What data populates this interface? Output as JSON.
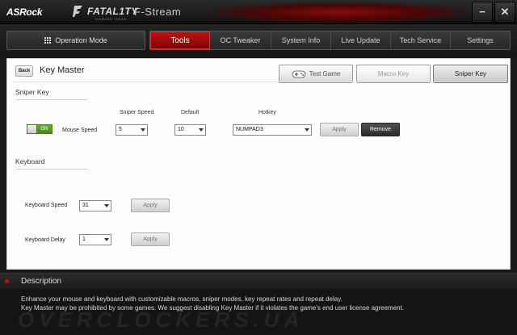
{
  "titlebar": {
    "brand": "ASRock",
    "fatality": "FATAL1TY",
    "fatality_sub": "GAMING GEAR",
    "app_name": "F-Stream",
    "min_label": "−",
    "close_label": "✕"
  },
  "tabs": {
    "operation_mode": "Operation Mode",
    "items": [
      "Tools",
      "OC Tweaker",
      "System Info",
      "Live Update",
      "Tech Service",
      "Settings"
    ],
    "active": "Tools"
  },
  "page": {
    "back_label": "Back",
    "title": "Key Master",
    "test_game_label": "Test Game",
    "macro_key_label": "Macro Key",
    "sniper_key_label": "Sniper Key"
  },
  "sniper": {
    "section_title": "Sniper Key",
    "toggle_label": "ON",
    "row_label": "Mouse Speed",
    "col_sniper_speed": "Sniper Speed",
    "col_default": "Default",
    "col_hotkey": "Hotkey",
    "sniper_speed_value": "5",
    "default_value": "10",
    "hotkey_value": "NUMPAD3",
    "apply_label": "Apply",
    "remove_label": "Remove"
  },
  "keyboard": {
    "section_title": "Keyboard",
    "speed_label": "Keyboard Speed",
    "speed_value": "31",
    "speed_apply": "Apply",
    "delay_label": "Keyboard Delay",
    "delay_value": "1",
    "delay_apply": "Apply"
  },
  "description": {
    "title": "Description",
    "line1": "Enhance your mouse and keyboard with customizable macros, sniper modes, key repeat rates and repeat delay.",
    "line2": "Key Master may be prohibited by some games. We suggest disabling Key Master if it violates the game's end user license agreement.",
    "watermark": "OVERCLOCKERS.UA"
  }
}
